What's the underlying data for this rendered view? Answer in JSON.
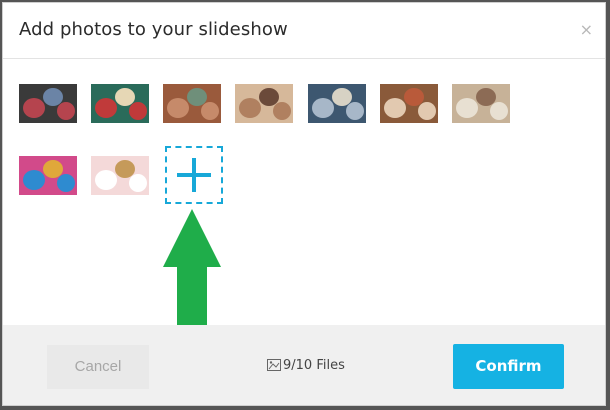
{
  "modal": {
    "title": "Add photos to your slideshow",
    "close_symbol": "×"
  },
  "photos": [
    {
      "name": "figurines-photo",
      "colors": [
        "#3a3a3a",
        "#b5444e",
        "#6b84a6"
      ]
    },
    {
      "name": "textile-crafts-photo",
      "colors": [
        "#2a6b5a",
        "#c03a3a",
        "#e6d7b5"
      ]
    },
    {
      "name": "spoons-photo",
      "colors": [
        "#9a5a3c",
        "#c68a6a",
        "#6f8f7a"
      ]
    },
    {
      "name": "bracelets-photo",
      "colors": [
        "#d6b89a",
        "#b08060",
        "#6b4a3a"
      ]
    },
    {
      "name": "lace-fabric-photo",
      "colors": [
        "#3d5770",
        "#a7b7c8",
        "#d7d2c4"
      ]
    },
    {
      "name": "dream-heart-photo",
      "colors": [
        "#8a5a3a",
        "#e2c9b0",
        "#b95a3a"
      ]
    },
    {
      "name": "flatlay-photo",
      "colors": [
        "#c7b298",
        "#e8e0d2",
        "#8c6b55"
      ]
    },
    {
      "name": "guitars-photo",
      "colors": [
        "#d24a8a",
        "#2e8bd0",
        "#e0a83a"
      ]
    },
    {
      "name": "pink-desk-stars-photo",
      "colors": [
        "#f4d9d9",
        "#ffffff",
        "#c59a5a"
      ]
    }
  ],
  "add_tile": {
    "icon": "plus-icon",
    "accent": "#17a8d8"
  },
  "arrow": {
    "icon": "up-arrow-icon",
    "color": "#1fad4a"
  },
  "footer": {
    "cancel_label": "Cancel",
    "file_count_label": "9/10 Files",
    "confirm_label": "Confirm",
    "confirm_color": "#15b2e3"
  }
}
